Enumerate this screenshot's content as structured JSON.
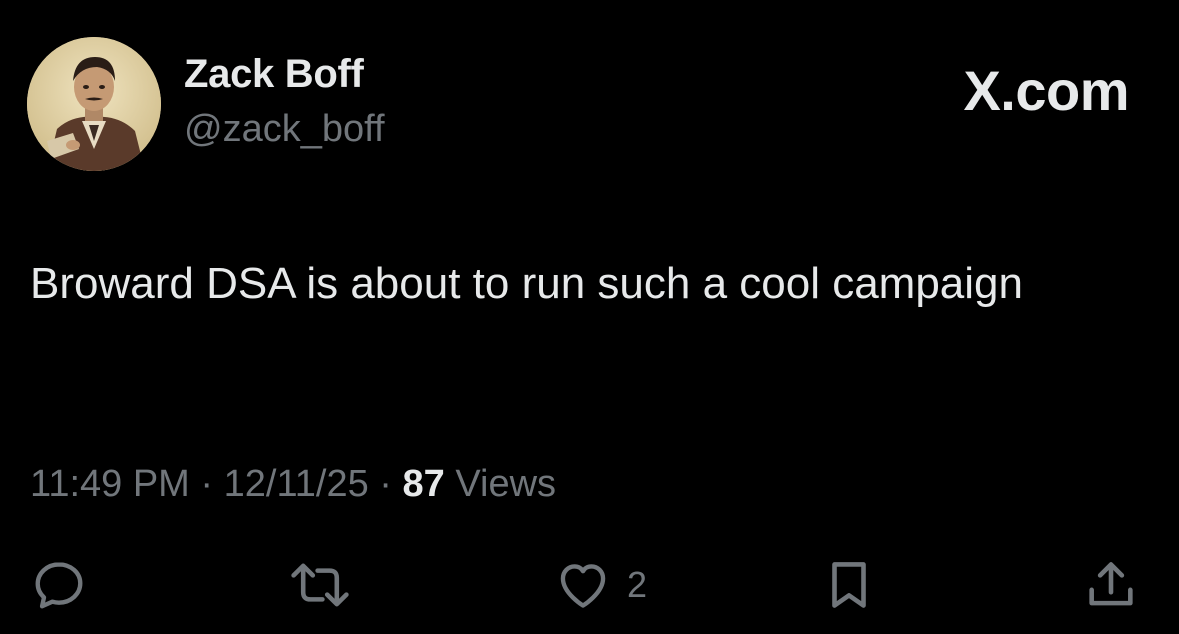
{
  "author": {
    "display_name": "Zack Boff",
    "handle": "@zack_boff",
    "avatar_icon": "profile-photo"
  },
  "brand": {
    "label": "X.com"
  },
  "tweet": {
    "text": "Broward DSA is about to run such a cool campaign",
    "time": "11:49 PM",
    "date": "12/11/25",
    "separator": "·",
    "views_count": "87",
    "views_label": "Views"
  },
  "actions": {
    "reply": {
      "icon": "reply-icon"
    },
    "repost": {
      "icon": "repost-icon"
    },
    "like": {
      "icon": "heart-icon",
      "count": "2"
    },
    "bookmark": {
      "icon": "bookmark-icon"
    },
    "share": {
      "icon": "share-icon"
    }
  },
  "colors": {
    "background": "#000000",
    "primary_text": "#e7e9ea",
    "secondary_text": "#71767b"
  }
}
